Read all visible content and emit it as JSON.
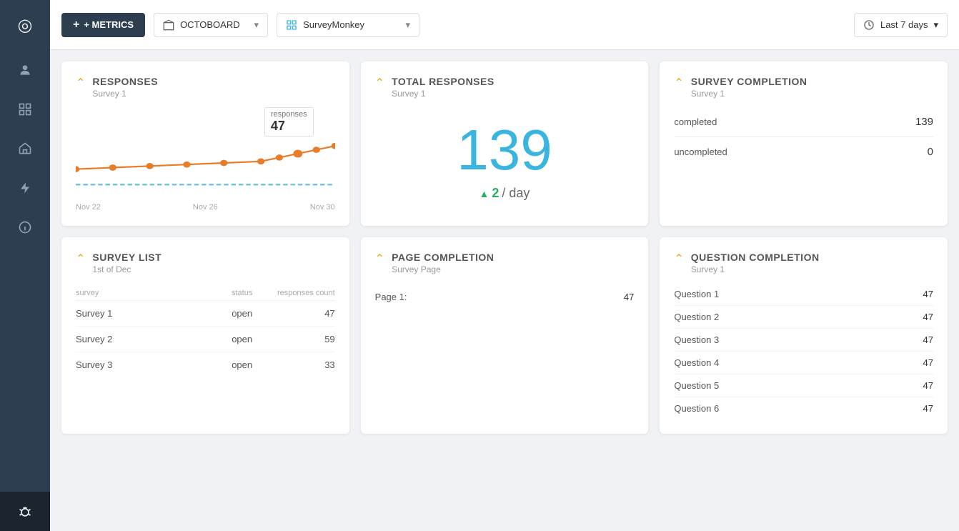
{
  "sidebar": {
    "items": [
      {
        "name": "logo",
        "label": "◎",
        "active": false
      },
      {
        "name": "person",
        "label": "👤",
        "active": false
      },
      {
        "name": "grid",
        "label": "⊞",
        "active": false
      },
      {
        "name": "bank",
        "label": "🏛",
        "active": false
      },
      {
        "name": "lightning",
        "label": "⚡",
        "active": false
      },
      {
        "name": "info",
        "label": "ℹ",
        "active": false
      },
      {
        "name": "bug",
        "label": "🐛",
        "active": true
      }
    ]
  },
  "topbar": {
    "add_label": "+ METRICS",
    "octoboard_label": "OCTOBOARD",
    "surveymonkey_label": "SurveyMonkey",
    "time_label": "Last 7 days"
  },
  "responses_card": {
    "title": "RESPONSES",
    "subtitle": "Survey 1",
    "tooltip_label": "responses",
    "tooltip_value": "47",
    "dates": [
      "Nov 22",
      "Nov 26",
      "Nov 30"
    ]
  },
  "total_responses_card": {
    "title": "TOTAL RESPONSES",
    "subtitle": "Survey 1",
    "value": "139",
    "per_day_value": "2",
    "per_day_label": "/ day"
  },
  "survey_completion_card": {
    "title": "SURVEY COMPLETION",
    "subtitle": "Survey 1",
    "rows": [
      {
        "label": "completed",
        "value": "139"
      },
      {
        "label": "uncompleted",
        "value": "0"
      }
    ]
  },
  "survey_list_card": {
    "title": "SURVEY LIST",
    "subtitle": "1st of Dec",
    "headers": {
      "survey": "survey",
      "status": "status",
      "count": "responses count"
    },
    "rows": [
      {
        "name": "Survey 1",
        "status": "open",
        "count": "47"
      },
      {
        "name": "Survey 2",
        "status": "open",
        "count": "59"
      },
      {
        "name": "Survey 3",
        "status": "open",
        "count": "33"
      }
    ]
  },
  "page_completion_card": {
    "title": "PAGE COMPLETION",
    "subtitle": "Survey Page",
    "rows": [
      {
        "label": "Page 1:",
        "value": "47"
      }
    ]
  },
  "question_completion_card": {
    "title": "QUESTION COMPLETION",
    "subtitle": "Survey 1",
    "rows": [
      {
        "label": "Question 1",
        "value": "47"
      },
      {
        "label": "Question 2",
        "value": "47"
      },
      {
        "label": "Question 3",
        "value": "47"
      },
      {
        "label": "Question 4",
        "value": "47"
      },
      {
        "label": "Question 5",
        "value": "47"
      },
      {
        "label": "Question 6",
        "value": "47"
      }
    ]
  }
}
